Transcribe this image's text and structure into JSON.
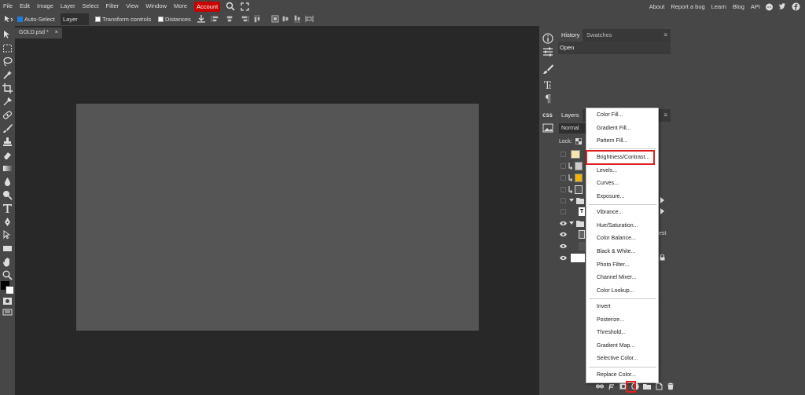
{
  "menubar": {
    "items": [
      "File",
      "Edit",
      "Image",
      "Layer",
      "Select",
      "Filter",
      "View",
      "Window",
      "More",
      "Account"
    ],
    "right_links": [
      "About",
      "Report a bug",
      "Learn",
      "Blog",
      "API"
    ]
  },
  "options": {
    "auto_select_label": "Auto-Select",
    "layer_select_value": "Layer",
    "transform_controls_label": "Transform controls",
    "distances_label": "Distances"
  },
  "document": {
    "tab_title": "GOLD.psd *",
    "close_glyph": "×"
  },
  "history_panel": {
    "tabs": [
      "History",
      "Swatches"
    ],
    "items": [
      "Open"
    ]
  },
  "layers_panel": {
    "tab": "Layers",
    "blend_mode": "Normal",
    "lock_label": "Lock:",
    "partial_text": "est"
  },
  "adjustment_menu": {
    "groups": [
      [
        "Color Fill...",
        "Gradient Fill...",
        "Pattern Fill..."
      ],
      [
        "Brightness/Contrast...",
        "Levels...",
        "Curves...",
        "Exposure..."
      ],
      [
        "Vibrance...",
        "Hue/Saturation...",
        "Color Balance...",
        "Black & White...",
        "Photo Filter...",
        "Channel Mixer...",
        "Color Lookup..."
      ],
      [
        "Invert",
        "Posterize...",
        "Threshold...",
        "Gradient Map...",
        "Selective Color..."
      ],
      [
        "Replace Color..."
      ]
    ],
    "highlighted": "Brightness/Contrast..."
  },
  "colors": {
    "accent_red": "#c80000",
    "highlight_border": "#e02020",
    "canvas": "#555555",
    "workspace": "#282828"
  }
}
